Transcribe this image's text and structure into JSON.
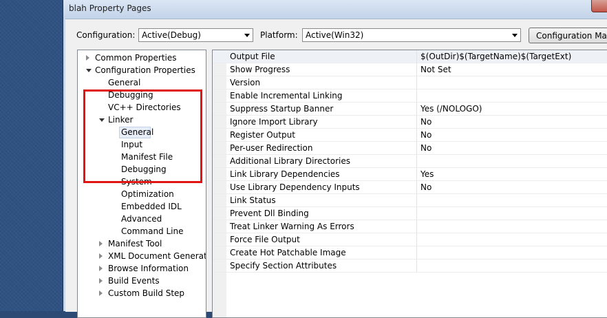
{
  "window": {
    "title": "blah Property Pages"
  },
  "toolbar": {
    "configuration_label": "Configuration:",
    "configuration_value": "Active(Debug)",
    "platform_label": "Platform:",
    "platform_value": "Active(Win32)",
    "configuration_manager_button": "Configuration Mana"
  },
  "tree": {
    "items": [
      {
        "label": "Common Properties",
        "expander": "collapsed"
      },
      {
        "label": "Configuration Properties",
        "expander": "expanded"
      },
      {
        "label": "General",
        "expander": "none"
      },
      {
        "label": "Debugging",
        "expander": "none"
      },
      {
        "label": "VC++ Directories",
        "expander": "none"
      },
      {
        "label": "Linker",
        "expander": "expanded"
      },
      {
        "label": "General",
        "expander": "none",
        "selected": true
      },
      {
        "label": "Input",
        "expander": "none"
      },
      {
        "label": "Manifest File",
        "expander": "none"
      },
      {
        "label": "Debugging",
        "expander": "none"
      },
      {
        "label": "System",
        "expander": "none"
      },
      {
        "label": "Optimization",
        "expander": "none"
      },
      {
        "label": "Embedded IDL",
        "expander": "none"
      },
      {
        "label": "Advanced",
        "expander": "none"
      },
      {
        "label": "Command Line",
        "expander": "none"
      },
      {
        "label": "Manifest Tool",
        "expander": "collapsed"
      },
      {
        "label": "XML Document Generator",
        "expander": "collapsed"
      },
      {
        "label": "Browse Information",
        "expander": "collapsed"
      },
      {
        "label": "Build Events",
        "expander": "collapsed"
      },
      {
        "label": "Custom Build Step",
        "expander": "collapsed"
      }
    ]
  },
  "grid": {
    "rows": [
      {
        "name": "Output File",
        "value": "$(OutDir)$(TargetName)$(TargetExt)"
      },
      {
        "name": "Show Progress",
        "value": "Not Set"
      },
      {
        "name": "Version",
        "value": ""
      },
      {
        "name": "Enable Incremental Linking",
        "value": ""
      },
      {
        "name": "Suppress Startup Banner",
        "value": "Yes (/NOLOGO)"
      },
      {
        "name": "Ignore Import Library",
        "value": "No"
      },
      {
        "name": "Register Output",
        "value": "No"
      },
      {
        "name": "Per-user Redirection",
        "value": "No"
      },
      {
        "name": "Additional Library Directories",
        "value": ""
      },
      {
        "name": "Link Library Dependencies",
        "value": "Yes"
      },
      {
        "name": "Use Library Dependency Inputs",
        "value": "No"
      },
      {
        "name": "Link Status",
        "value": ""
      },
      {
        "name": "Prevent Dll Binding",
        "value": ""
      },
      {
        "name": "Treat Linker Warning As Errors",
        "value": ""
      },
      {
        "name": "Force File Output",
        "value": ""
      },
      {
        "name": "Create Hot Patchable Image",
        "value": ""
      },
      {
        "name": "Specify Section Attributes",
        "value": ""
      }
    ]
  },
  "colors": {
    "highlight_box": "#e11414"
  }
}
